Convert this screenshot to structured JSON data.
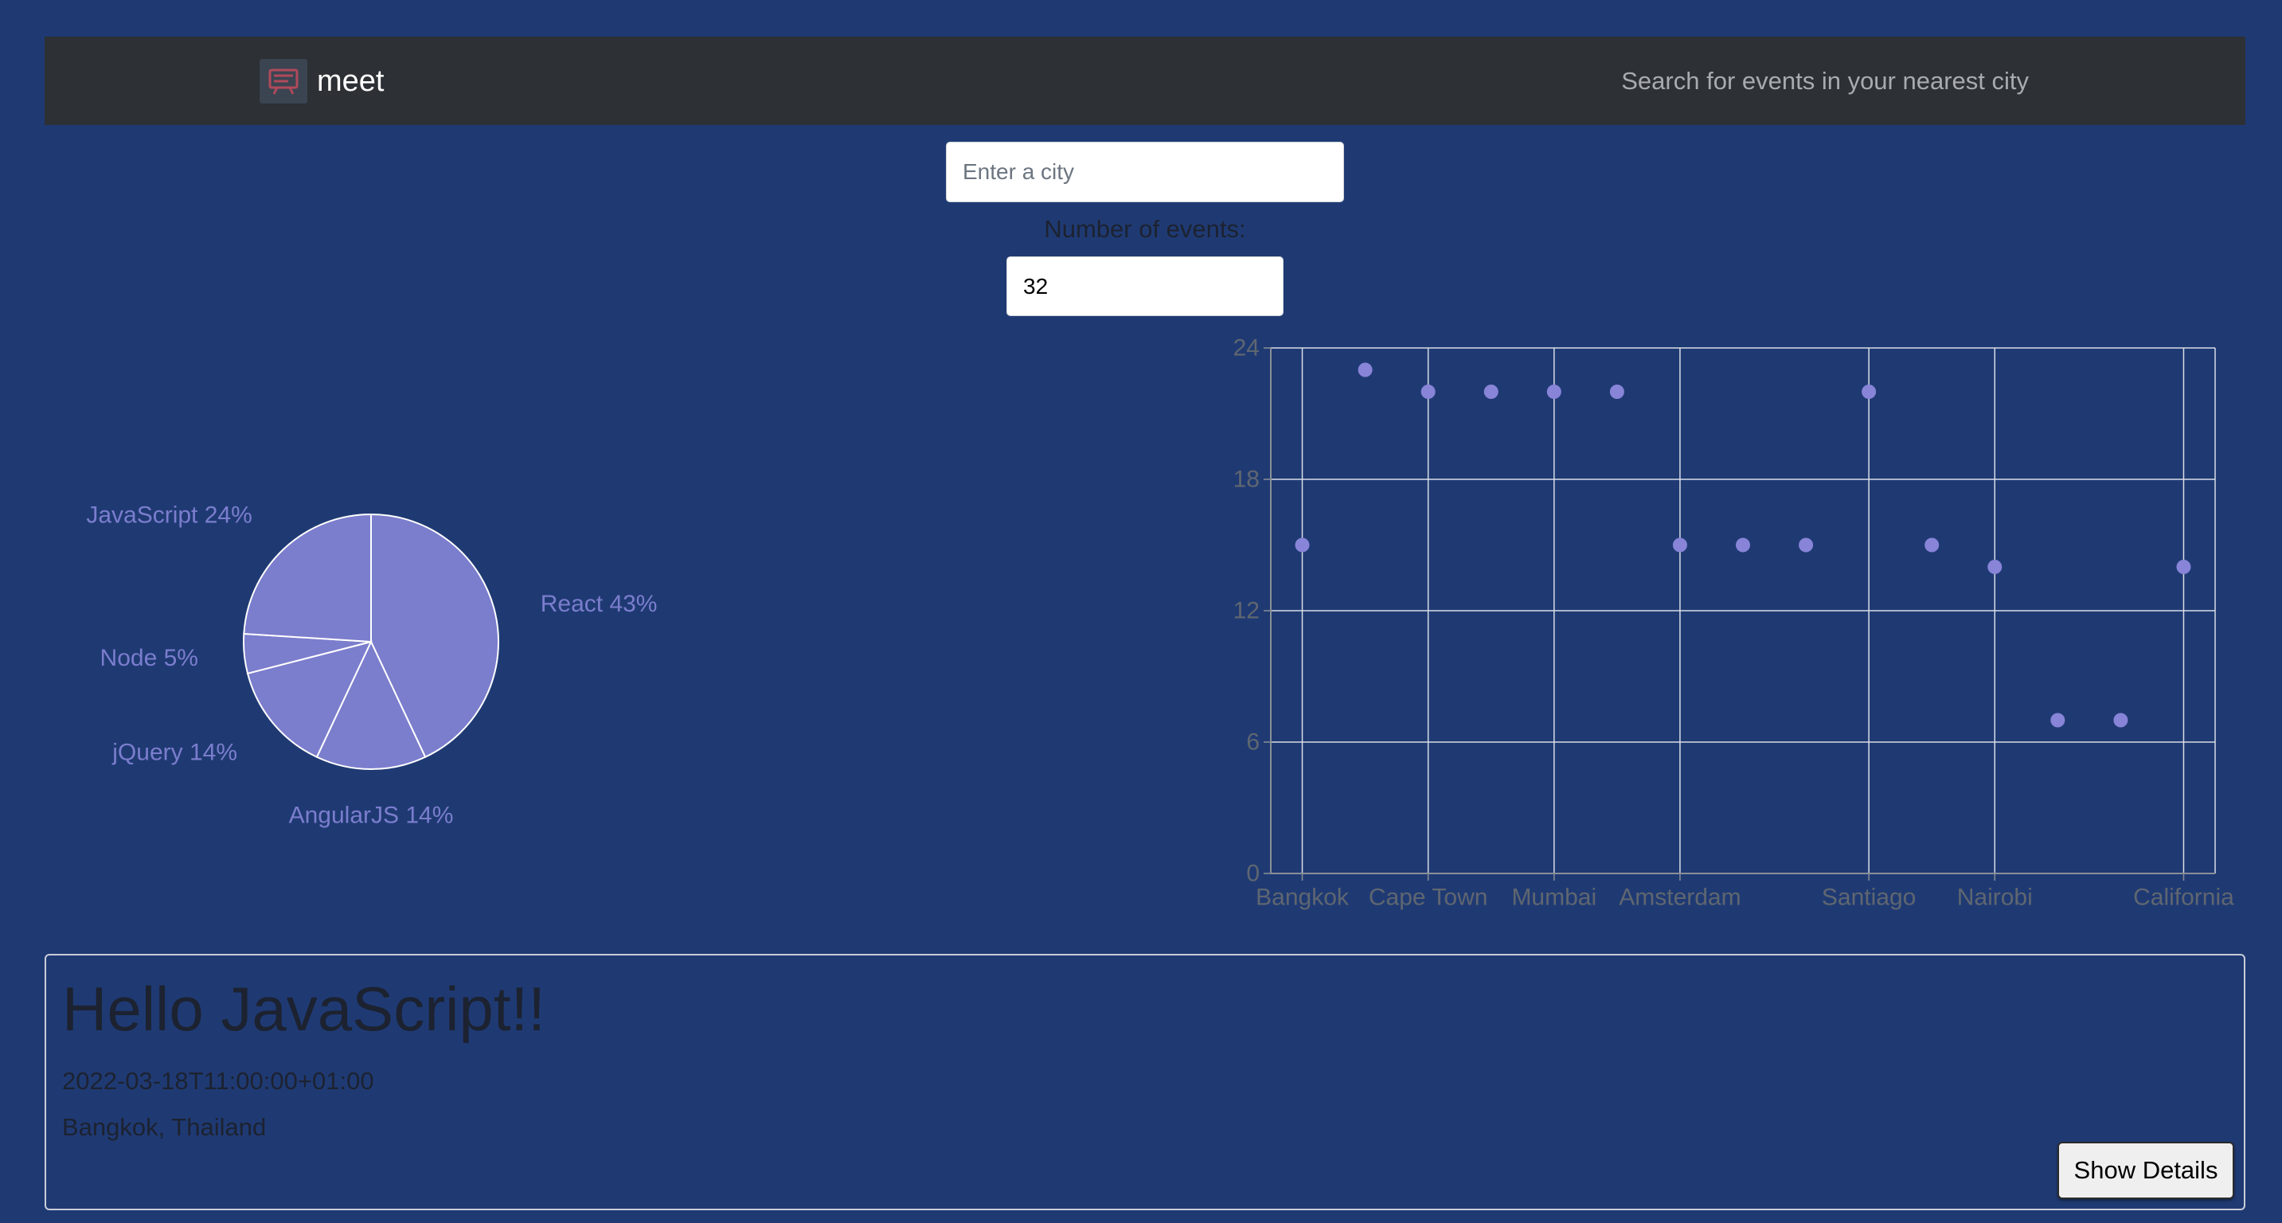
{
  "navbar": {
    "brand": "meet",
    "tagline": "Search for events in your nearest city"
  },
  "search": {
    "city_placeholder": "Enter a city",
    "events_label": "Number of events:",
    "events_value": "32"
  },
  "chart_data": [
    {
      "type": "pie",
      "slices": [
        {
          "label": "React 43%",
          "value": 43
        },
        {
          "label": "AngularJS 14%",
          "value": 14
        },
        {
          "label": "jQuery 14%",
          "value": 14
        },
        {
          "label": "Node 5%",
          "value": 5
        },
        {
          "label": "JavaScript 24%",
          "value": 24
        }
      ],
      "color": "#7b7dcd",
      "stroke": "#ffffff"
    },
    {
      "type": "scatter",
      "x_tick_labels": [
        "Bangkok",
        "Cape Town",
        "Mumbai",
        "Amsterdam",
        "Santiago",
        "Nairobi",
        "California"
      ],
      "x_tick_index": [
        0,
        2,
        4,
        6,
        9,
        11,
        14
      ],
      "y": [
        15,
        23,
        22,
        22,
        22,
        22,
        15,
        15,
        15,
        22,
        15,
        14,
        7,
        7,
        14
      ],
      "ylim": [
        0,
        24
      ],
      "yticks": [
        0,
        6,
        12,
        18,
        24
      ],
      "grid": true,
      "color": "#8884d8"
    }
  ],
  "event": {
    "title": "Hello JavaScript!!",
    "date": "2022-03-18T11:00:00+01:00",
    "location": "Bangkok, Thailand",
    "button": "Show Details"
  }
}
